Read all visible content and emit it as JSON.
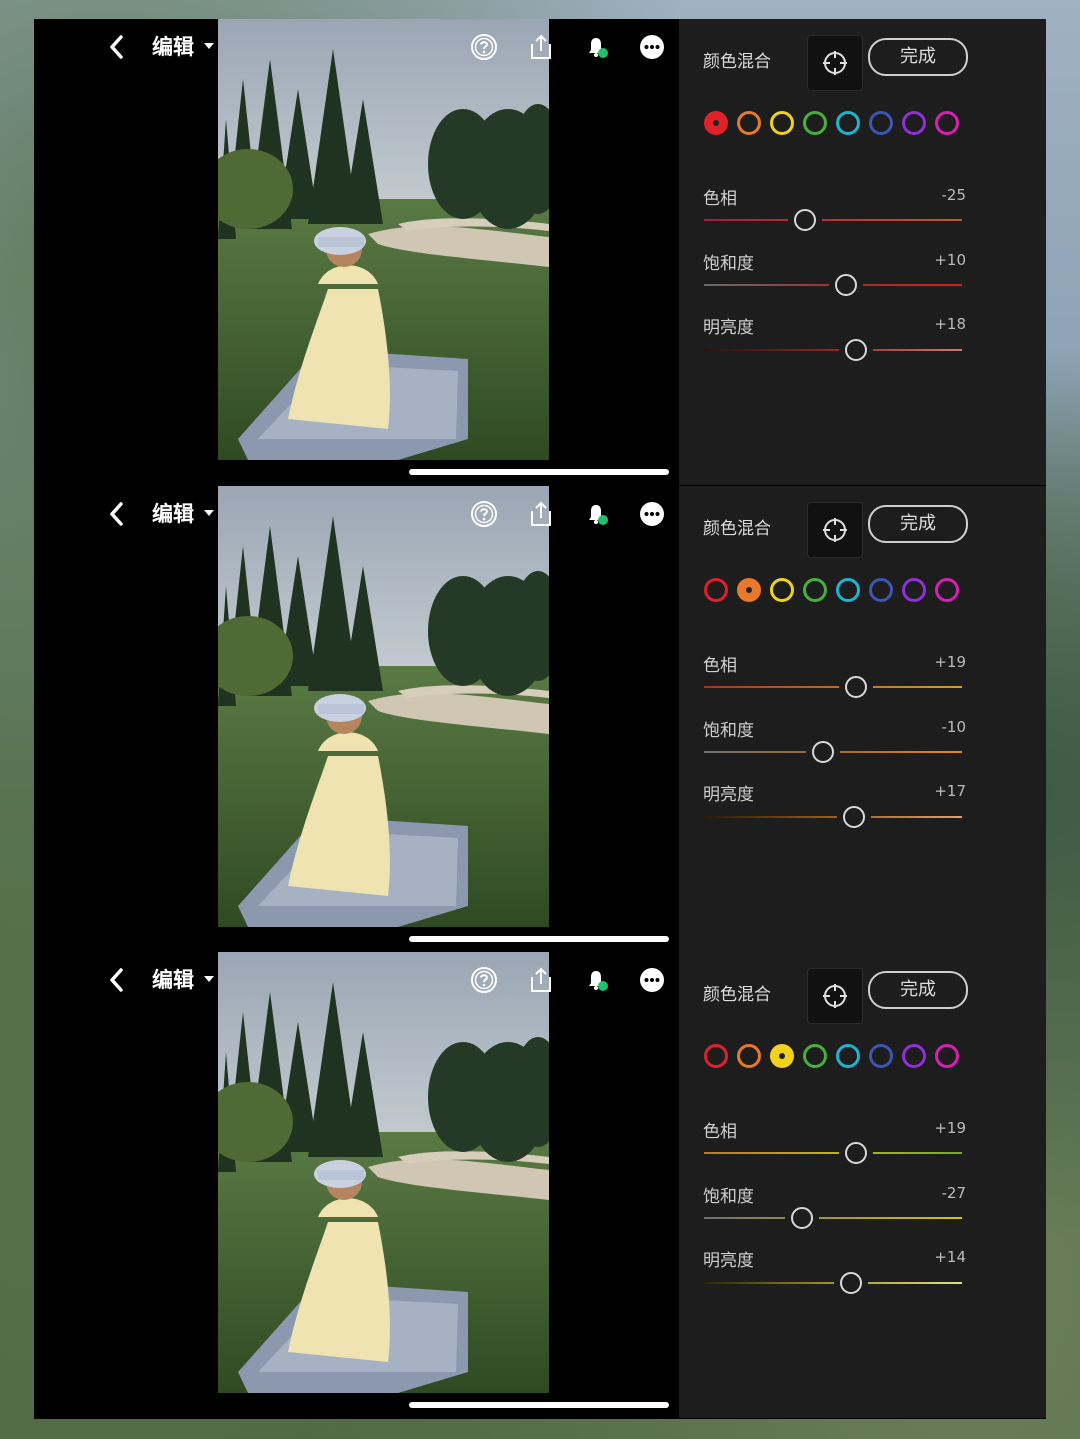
{
  "topbar": {
    "title": "编辑"
  },
  "panel": {
    "title": "颜色混合",
    "done_label": "完成"
  },
  "swatch_colors": [
    "#e0202a",
    "#e8782a",
    "#f0d21c",
    "#46b03c",
    "#1eb4d0",
    "#3e55b4",
    "#8e30d8",
    "#d81eb4"
  ],
  "sections": [
    {
      "active_swatch": 0,
      "sliders": [
        {
          "label": "色相",
          "value": "-25",
          "pos": 0.39,
          "colors": [
            "#a0203a",
            "#c03030",
            "#c05a20"
          ]
        },
        {
          "label": "饱和度",
          "value": "+10",
          "pos": 0.55,
          "colors": [
            "#6a6a6a",
            "#a03030",
            "#d02020"
          ]
        },
        {
          "label": "明亮度",
          "value": "+18",
          "pos": 0.59,
          "colors": [
            "#2a1010",
            "#a02020",
            "#e07070"
          ]
        }
      ]
    },
    {
      "active_swatch": 1,
      "sliders": [
        {
          "label": "色相",
          "value": "+19",
          "pos": 0.59,
          "colors": [
            "#b03020",
            "#c06a20",
            "#d0a020"
          ]
        },
        {
          "label": "饱和度",
          "value": "-10",
          "pos": 0.46,
          "colors": [
            "#707070",
            "#a06a30",
            "#e08a20"
          ]
        },
        {
          "label": "明亮度",
          "value": "+17",
          "pos": 0.58,
          "colors": [
            "#2a1a08",
            "#a05a18",
            "#e0a070"
          ]
        }
      ]
    },
    {
      "active_swatch": 2,
      "sliders": [
        {
          "label": "色相",
          "value": "+19",
          "pos": 0.59,
          "colors": [
            "#c07a20",
            "#c0b020",
            "#70b020"
          ]
        },
        {
          "label": "饱和度",
          "value": "-27",
          "pos": 0.38,
          "colors": [
            "#707070",
            "#a09a30",
            "#d8c020"
          ]
        },
        {
          "label": "明亮度",
          "value": "+14",
          "pos": 0.57,
          "colors": [
            "#2a2608",
            "#a09a18",
            "#e0e080"
          ]
        }
      ]
    }
  ]
}
